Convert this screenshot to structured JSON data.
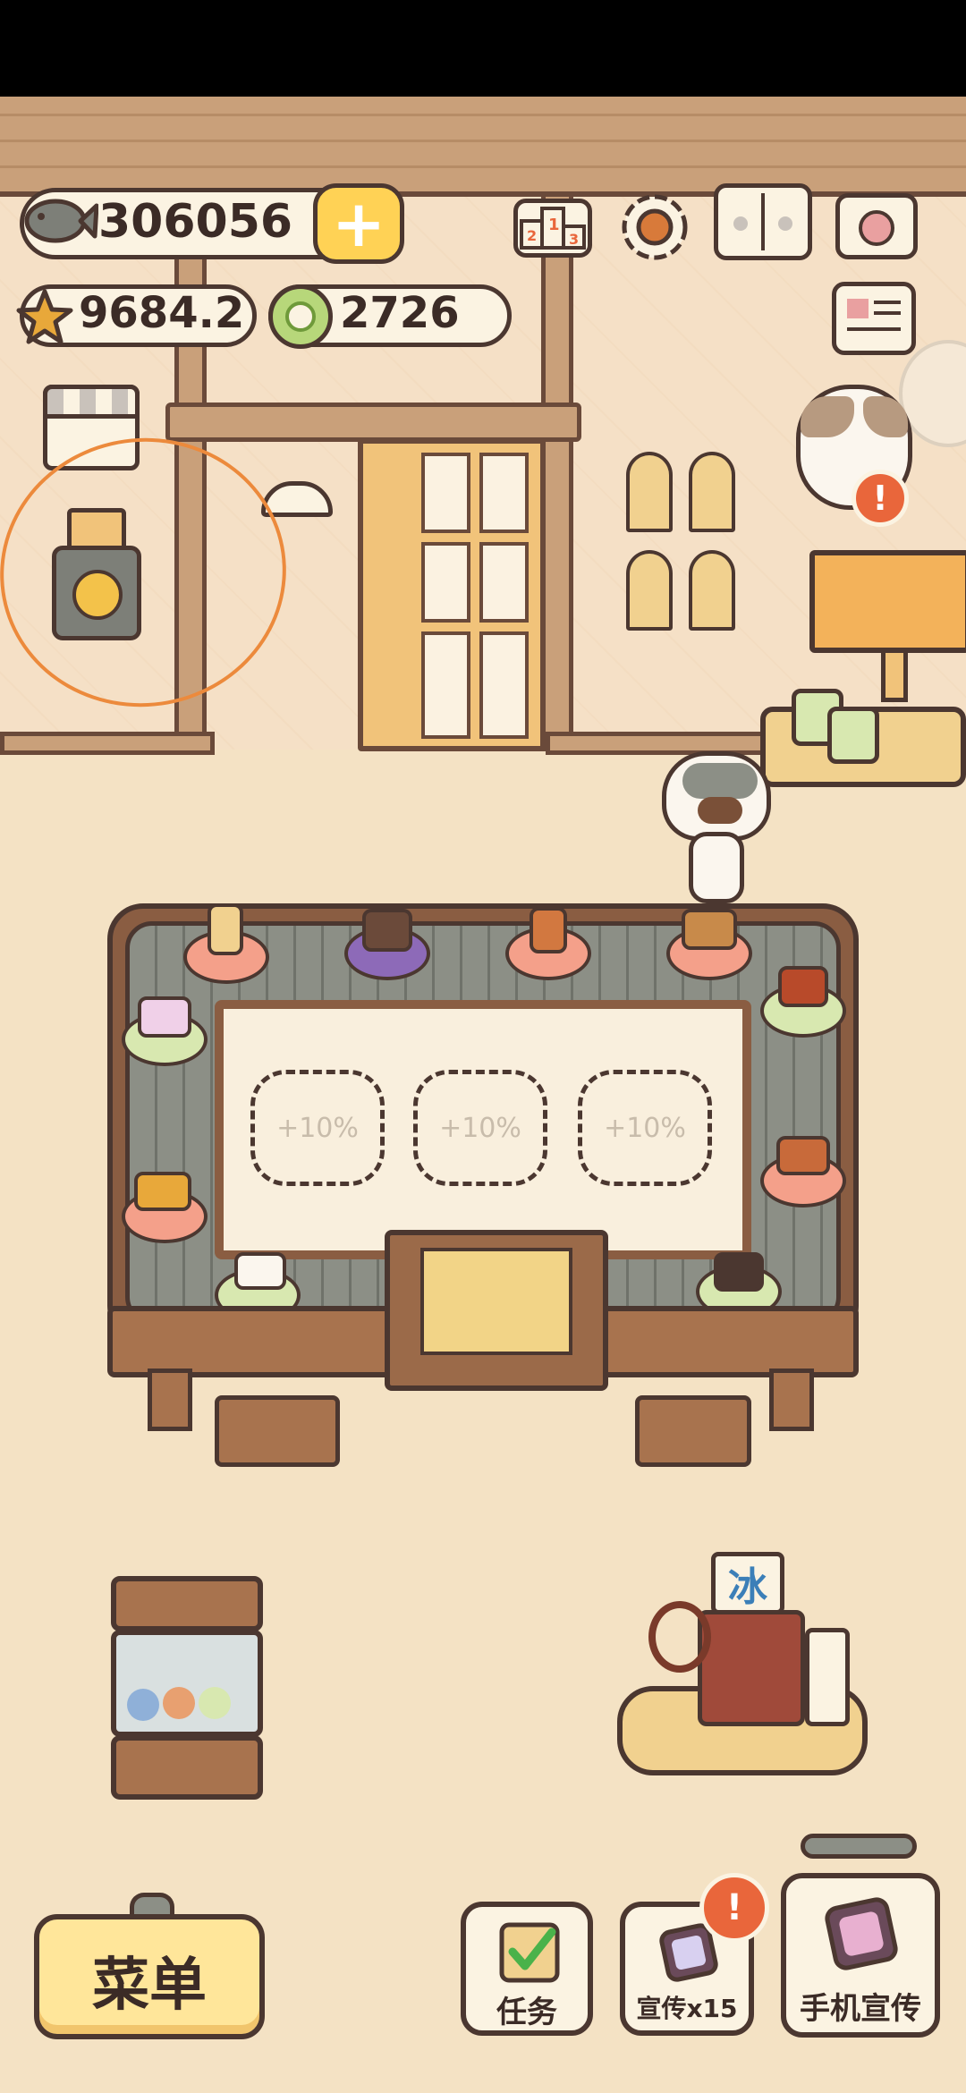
{
  "currencies": {
    "fish": "306056",
    "star": "9684.2",
    "coin": "2726"
  },
  "plus_symbol": "+",
  "seats": [
    "+10%",
    "+10%",
    "+10%"
  ],
  "badges": {
    "cat_alert": "!",
    "promo_alert": "!"
  },
  "ice_sign": "冰",
  "bottom_bar": {
    "menu_label": "菜单",
    "tasks_label": "任务",
    "promo_label": "宣传x15",
    "phone_promo_label": "手机宣传"
  },
  "icons": {
    "top_right": [
      "ranking-podium-icon",
      "gear-icon",
      "paw-book-icon",
      "camera-icon",
      "newspaper-icon"
    ],
    "accent": "#ffd255",
    "badge_color": "#e9663b",
    "annotation_color": "#ec8a3c"
  }
}
